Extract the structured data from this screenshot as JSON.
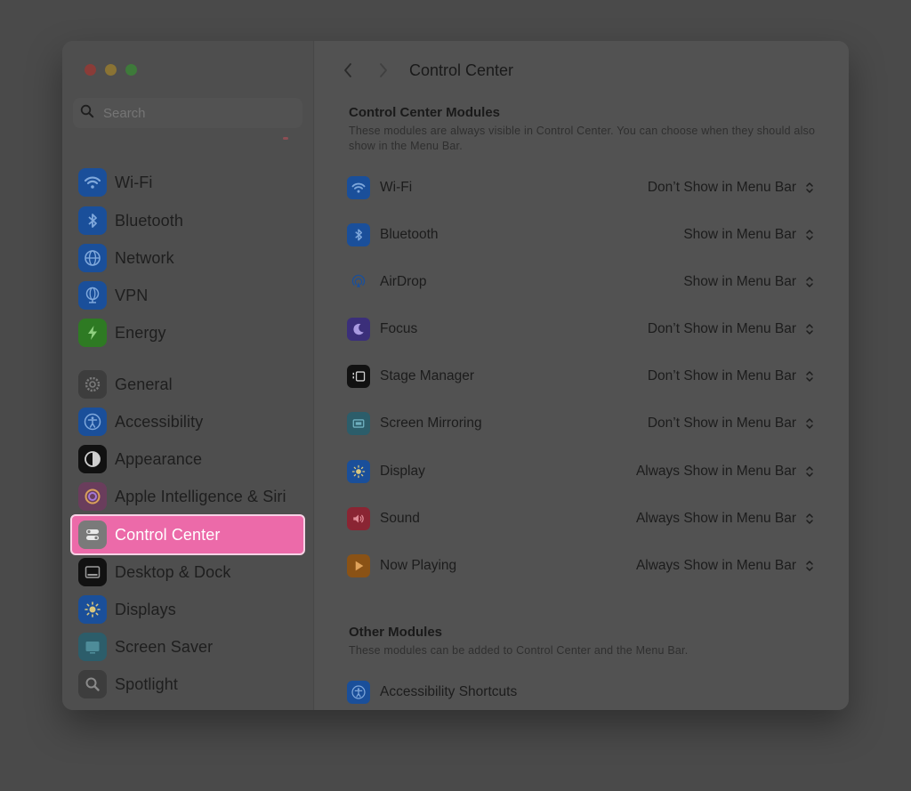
{
  "window_title": "Control Center",
  "search": {
    "placeholder": "Search"
  },
  "sidebar": {
    "items": [
      {
        "label": "Wi-Fi",
        "icon": "wifi-icon",
        "color": "#1a4f9a"
      },
      {
        "label": "Bluetooth",
        "icon": "bluetooth-icon",
        "color": "#1a4f9a"
      },
      {
        "label": "Network",
        "icon": "globe-icon",
        "color": "#1a4f9a"
      },
      {
        "label": "VPN",
        "icon": "vpn-globe-icon",
        "color": "#1a4f9a"
      },
      {
        "label": "Energy",
        "icon": "battery-bolt-icon",
        "color": "#2e7a23"
      },
      {
        "label": "General",
        "icon": "gear-icon",
        "color": "#3d3d3d"
      },
      {
        "label": "Accessibility",
        "icon": "accessibility-icon",
        "color": "#1a4f9a"
      },
      {
        "label": "Appearance",
        "icon": "appearance-icon",
        "color": "#111111"
      },
      {
        "label": "Apple Intelligence & Siri",
        "icon": "siri-icon",
        "color": "#6a3d5c"
      },
      {
        "label": "Control Center",
        "icon": "control-center-icon",
        "color": "#7a7a7a"
      },
      {
        "label": "Desktop & Dock",
        "icon": "dock-icon",
        "color": "#111111"
      },
      {
        "label": "Displays",
        "icon": "brightness-icon",
        "color": "#1a4f9a"
      },
      {
        "label": "Screen Saver",
        "icon": "screen-saver-icon",
        "color": "#2c5d6a"
      },
      {
        "label": "Spotlight",
        "icon": "magnifier-icon",
        "color": "#3d3d3d"
      }
    ]
  },
  "main": {
    "modules_title": "Control Center Modules",
    "modules_desc": "These modules are always visible in Control Center. You can choose when they should also show in the Menu Bar.",
    "modules": [
      {
        "label": "Wi-Fi",
        "value": "Don’t Show in Menu Bar",
        "icon": "wifi-icon",
        "color": "#1a4f9a"
      },
      {
        "label": "Bluetooth",
        "value": "Show in Menu Bar",
        "icon": "bluetooth-icon",
        "color": "#1a4f9a"
      },
      {
        "label": "AirDrop",
        "value": "Show in Menu Bar",
        "icon": "airdrop-icon",
        "color": "#525252"
      },
      {
        "label": "Focus",
        "value": "Don’t Show in Menu Bar",
        "icon": "moon-icon",
        "color": "#3b2f7a"
      },
      {
        "label": "Stage Manager",
        "value": "Don’t Show in Menu Bar",
        "icon": "stage-manager-icon",
        "color": "#111111"
      },
      {
        "label": "Screen Mirroring",
        "value": "Don’t Show in Menu Bar",
        "icon": "screen-mirroring-icon",
        "color": "#2c5d6a"
      },
      {
        "label": "Display",
        "value": "Always Show in Menu Bar",
        "icon": "brightness-icon",
        "color": "#1a4f9a"
      },
      {
        "label": "Sound",
        "value": "Always Show in Menu Bar",
        "icon": "speaker-icon",
        "color": "#8a2533"
      },
      {
        "label": "Now Playing",
        "value": "Always Show in Menu Bar",
        "icon": "play-icon",
        "color": "#8a5215"
      }
    ],
    "other_title": "Other Modules",
    "other_desc": "These modules can be added to Control Center and the Menu Bar.",
    "other": [
      {
        "label": "Accessibility Shortcuts",
        "icon": "accessibility-icon",
        "color": "#1a4f9a"
      }
    ]
  }
}
